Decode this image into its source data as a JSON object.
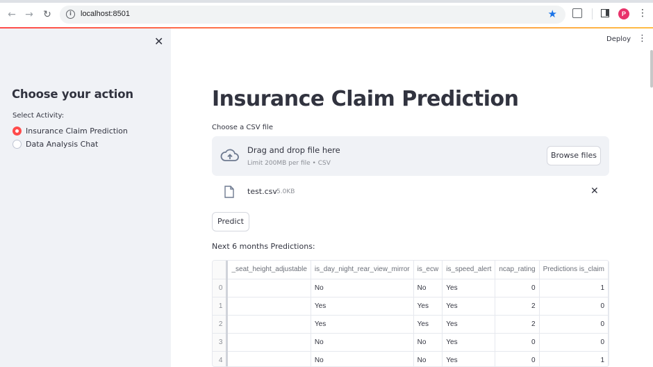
{
  "browser": {
    "url": "localhost:8501",
    "profile_initial": "P"
  },
  "sidebar": {
    "heading": "Choose your action",
    "radio_label": "Select Activity:",
    "options": [
      {
        "label": "Insurance Claim Prediction",
        "selected": true
      },
      {
        "label": "Data Analysis Chat",
        "selected": false
      }
    ]
  },
  "header": {
    "deploy_label": "Deploy"
  },
  "main": {
    "title": "Insurance Claim Prediction",
    "upload_label": "Choose a CSV file",
    "dropzone_title": "Drag and drop file here",
    "dropzone_sub": "Limit 200MB per file • CSV",
    "browse_label": "Browse files",
    "file_name": "test.csv",
    "file_size": "5.0KB",
    "predict_label": "Predict",
    "predictions_heading": "Next 6 months Predictions:"
  },
  "table": {
    "columns": [
      "_seat_height_adjustable",
      "is_day_night_rear_view_mirror",
      "is_ecw",
      "is_speed_alert",
      "ncap_rating",
      "Predictions is_claim"
    ],
    "rows": [
      {
        "index": "0",
        "cells": [
          "",
          "No",
          "No",
          "Yes",
          "0",
          "1"
        ]
      },
      {
        "index": "1",
        "cells": [
          "",
          "Yes",
          "Yes",
          "Yes",
          "2",
          "0"
        ]
      },
      {
        "index": "2",
        "cells": [
          "",
          "Yes",
          "Yes",
          "Yes",
          "2",
          "0"
        ]
      },
      {
        "index": "3",
        "cells": [
          "",
          "No",
          "No",
          "Yes",
          "0",
          "0"
        ]
      },
      {
        "index": "4",
        "cells": [
          "",
          "No",
          "No",
          "Yes",
          "0",
          "1"
        ]
      }
    ]
  },
  "colors": {
    "accent": "#ff4b4b",
    "sidebar_bg": "#f0f2f6",
    "text": "#31333f"
  }
}
